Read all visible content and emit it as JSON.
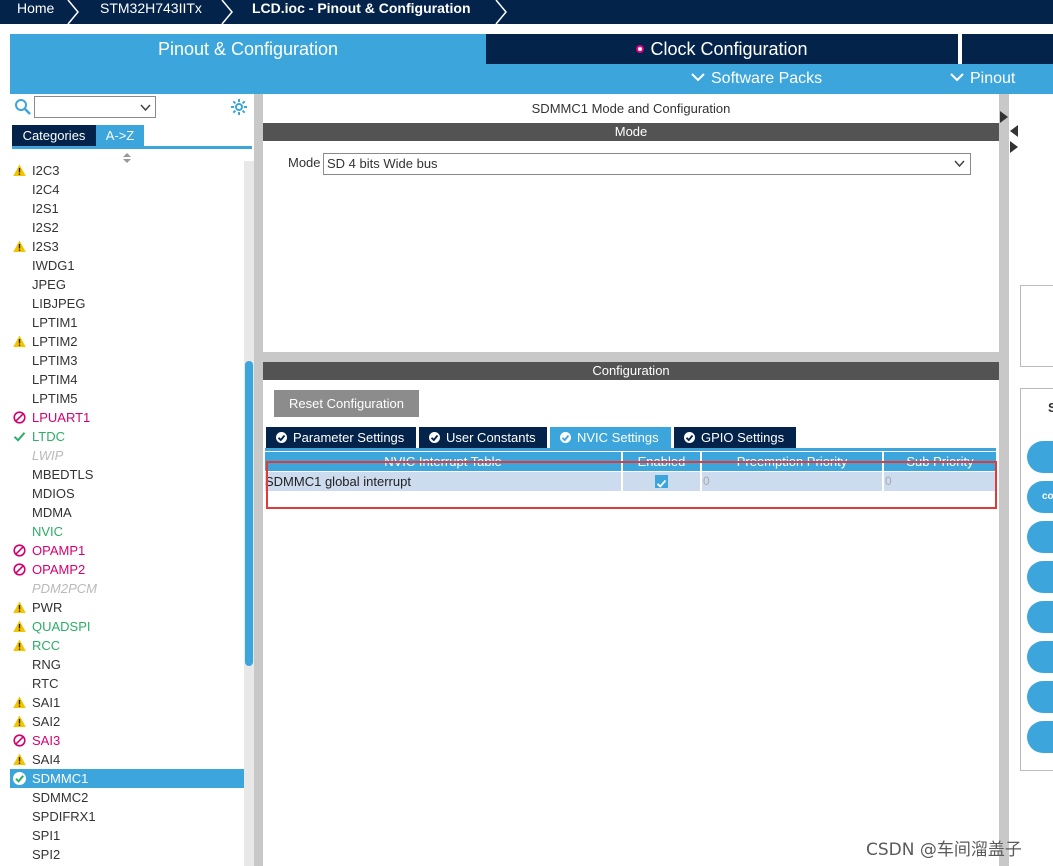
{
  "breadcrumb": {
    "home": "Home",
    "device": "STM32H743IITx",
    "file": "LCD.ioc - Pinout & Configuration"
  },
  "main_tabs": {
    "pinout": "Pinout & Configuration",
    "clock": "Clock Configuration"
  },
  "sub_bar": {
    "software_packs": "Software Packs",
    "pinout": "Pinout"
  },
  "left_panel": {
    "search_value": "",
    "tab_categories": "Categories",
    "tab_az": "A->Z",
    "items": [
      {
        "label": "I2C3",
        "status": "warning",
        "color": "#333333"
      },
      {
        "label": "I2C4",
        "status": "none",
        "color": "#333333"
      },
      {
        "label": "I2S1",
        "status": "none",
        "color": "#333333"
      },
      {
        "label": "I2S2",
        "status": "none",
        "color": "#333333"
      },
      {
        "label": "I2S3",
        "status": "warning",
        "color": "#333333"
      },
      {
        "label": "IWDG1",
        "status": "none",
        "color": "#333333"
      },
      {
        "label": "JPEG",
        "status": "none",
        "color": "#333333"
      },
      {
        "label": "LIBJPEG",
        "status": "none",
        "color": "#333333"
      },
      {
        "label": "LPTIM1",
        "status": "none",
        "color": "#333333"
      },
      {
        "label": "LPTIM2",
        "status": "warning",
        "color": "#333333"
      },
      {
        "label": "LPTIM3",
        "status": "none",
        "color": "#333333"
      },
      {
        "label": "LPTIM4",
        "status": "none",
        "color": "#333333"
      },
      {
        "label": "LPTIM5",
        "status": "none",
        "color": "#333333"
      },
      {
        "label": "LPUART1",
        "status": "disabled",
        "color": "#d6006f"
      },
      {
        "label": "LTDC",
        "status": "ok",
        "color": "#2bae66"
      },
      {
        "label": "LWIP",
        "status": "none",
        "color": "#b9b9b9"
      },
      {
        "label": "MBEDTLS",
        "status": "none",
        "color": "#333333"
      },
      {
        "label": "MDIOS",
        "status": "none",
        "color": "#333333"
      },
      {
        "label": "MDMA",
        "status": "none",
        "color": "#333333"
      },
      {
        "label": "NVIC",
        "status": "none",
        "color": "#2bae66"
      },
      {
        "label": "OPAMP1",
        "status": "disabled",
        "color": "#d6006f"
      },
      {
        "label": "OPAMP2",
        "status": "disabled",
        "color": "#d6006f"
      },
      {
        "label": "PDM2PCM",
        "status": "none",
        "color": "#b9b9b9"
      },
      {
        "label": "PWR",
        "status": "warning",
        "color": "#333333"
      },
      {
        "label": "QUADSPI",
        "status": "warning",
        "color": "#2bae66"
      },
      {
        "label": "RCC",
        "status": "warning",
        "color": "#2bae66"
      },
      {
        "label": "RNG",
        "status": "none",
        "color": "#333333"
      },
      {
        "label": "RTC",
        "status": "none",
        "color": "#333333"
      },
      {
        "label": "SAI1",
        "status": "warning",
        "color": "#333333"
      },
      {
        "label": "SAI2",
        "status": "warning",
        "color": "#333333"
      },
      {
        "label": "SAI3",
        "status": "disabled",
        "color": "#d6006f"
      },
      {
        "label": "SAI4",
        "status": "warning",
        "color": "#333333"
      },
      {
        "label": "SDMMC1",
        "status": "ok-selected",
        "color": "#ffffff"
      },
      {
        "label": "SDMMC2",
        "status": "none",
        "color": "#333333"
      },
      {
        "label": "SPDIFRX1",
        "status": "none",
        "color": "#333333"
      },
      {
        "label": "SPI1",
        "status": "none",
        "color": "#333333"
      },
      {
        "label": "SPI2",
        "status": "none",
        "color": "#333333"
      }
    ]
  },
  "center": {
    "title": "SDMMC1 Mode and Configuration",
    "mode_header": "Mode",
    "mode_label": "Mode",
    "mode_value": "SD 4 bits Wide bus",
    "config_header": "Configuration",
    "reset_button": "Reset Configuration",
    "tabs": [
      {
        "label": "Parameter Settings",
        "active": false
      },
      {
        "label": "User Constants",
        "active": false
      },
      {
        "label": "NVIC Settings",
        "active": true
      },
      {
        "label": "GPIO Settings",
        "active": false
      }
    ],
    "table": {
      "headers": [
        "NVIC Interrupt Table",
        "Enabled",
        "Preemption Priority",
        "Sub Priority"
      ],
      "rows": [
        {
          "name": "SDMMC1 global interrupt",
          "enabled": true,
          "preemption": "0",
          "sub": "0"
        }
      ]
    }
  },
  "right_panel": {
    "label_s": "S",
    "pill_text": "co"
  },
  "watermark": "CSDN @车间溜盖子",
  "colors": {
    "navy": "#03234b",
    "accent": "#3ca5dc",
    "warning": "#f5c400",
    "ok": "#2bae66",
    "disabled": "#d6006f",
    "highlight": "#e03a3a"
  }
}
